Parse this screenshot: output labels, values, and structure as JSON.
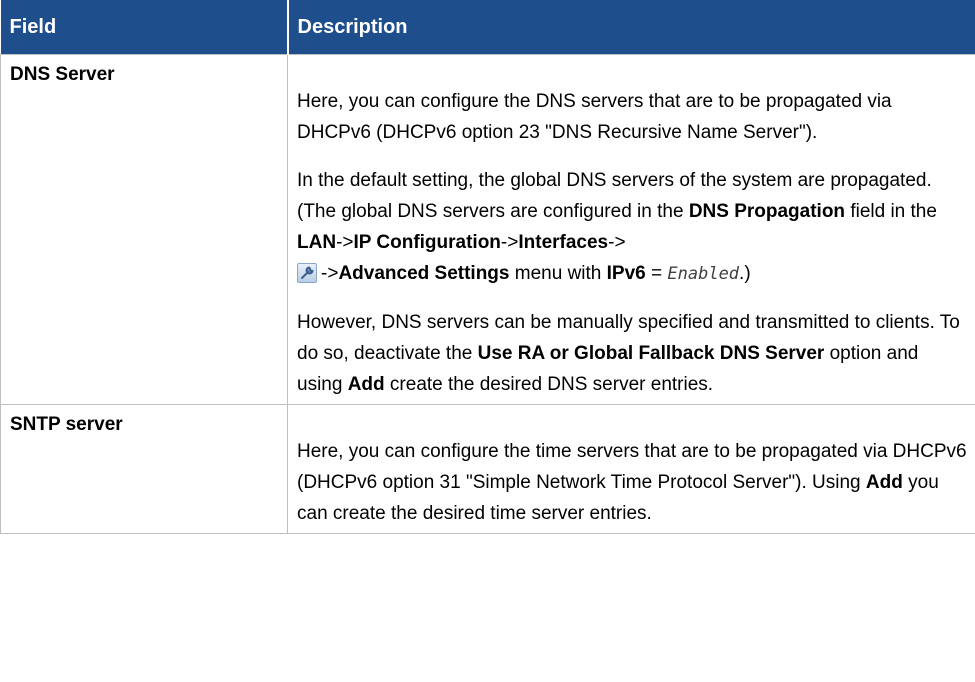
{
  "table": {
    "headers": {
      "field": "Field",
      "description": "Description"
    },
    "rows": [
      {
        "field": "DNS Server",
        "paragraphs": [
          "Here, you can configure the DNS servers that are to be propagated via DHCPv6 (DHCPv6 option 23 \"DNS Recursive Name Server\").",
          {
            "t1": "In the default setting, the global DNS servers of the system are propagated. (The global DNS servers are configured in the ",
            "b1": "DNS Propagation",
            "t2": " field in the ",
            "b2": "LAN",
            "t3": "->",
            "b3": "IP Configuration",
            "t4": "->",
            "b4": "Interfaces",
            "t5": "->",
            "icon": "wrench-icon",
            "t6": "->",
            "b5": "Advanced Settings",
            "t7": " menu with ",
            "b6": "IPv6",
            "t8": " = ",
            "code": "Enabled",
            "t9": ".)"
          },
          {
            "t1": "However, DNS servers can be manually specified and transmitted to clients. To do so, deactivate the ",
            "b1": "Use RA or Global Fallback DNS Server",
            "t2": " option and using ",
            "b2": "Add",
            "t3": " create the desired DNS server entries."
          }
        ]
      },
      {
        "field": "SNTP server",
        "paragraphs": [
          {
            "t1": "Here, you can configure the time servers that are to be propagated via DHCPv6 (DHCPv6 option 31 \"Simple Network Time Protocol Server\"). Using ",
            "b1": "Add",
            "t2": " you can create the desired time server entries."
          }
        ]
      }
    ]
  }
}
